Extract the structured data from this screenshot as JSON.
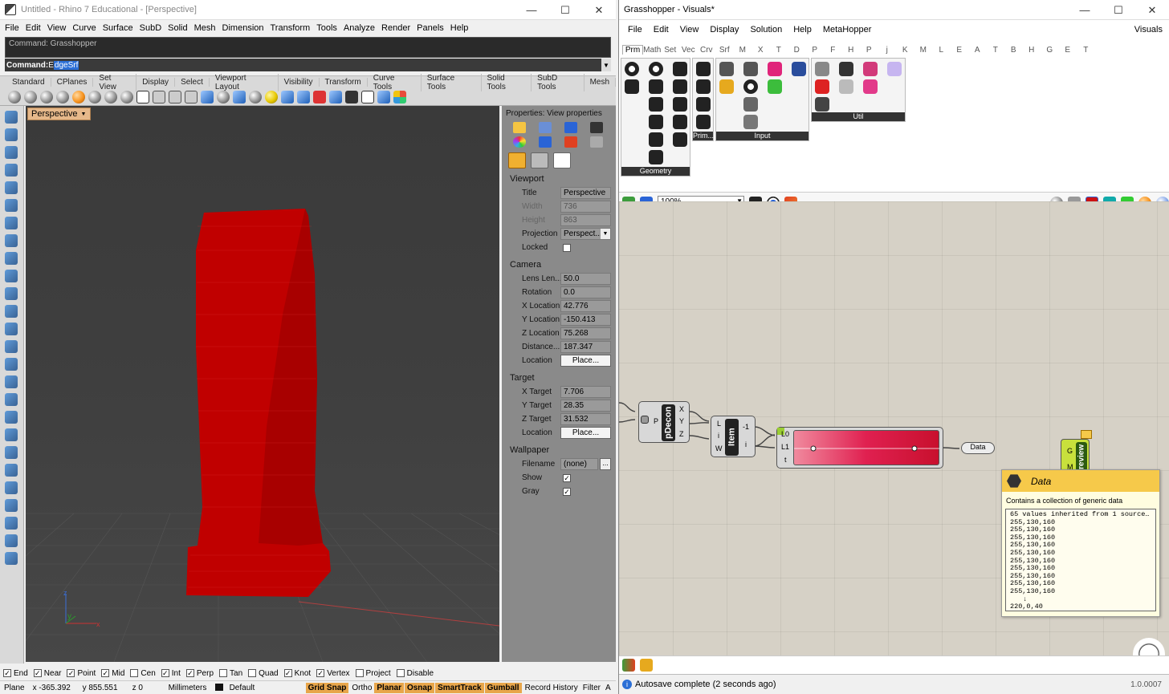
{
  "rhino": {
    "title": "Untitled - Rhino 7 Educational - [Perspective]",
    "menu": [
      "File",
      "Edit",
      "View",
      "Curve",
      "Surface",
      "SubD",
      "Solid",
      "Mesh",
      "Dimension",
      "Transform",
      "Tools",
      "Analyze",
      "Render",
      "Panels",
      "Help"
    ],
    "command_history": "Command: Grasshopper",
    "command_prefix": "Command: ",
    "command_first": "E",
    "command_selected": "dgeSrf",
    "toolbar_tabs": [
      "Standard",
      "CPlanes",
      "Set View",
      "Display",
      "Select",
      "Viewport Layout",
      "Visibility",
      "Transform",
      "Curve Tools",
      "Surface Tools",
      "Solid Tools",
      "SubD Tools",
      "Mesh"
    ],
    "viewport_label": "Perspective",
    "axis_x": "x",
    "axis_y": "y",
    "axis_z": "z",
    "model_color": "#cc0000",
    "properties": {
      "header": "Properties: View properties",
      "viewport_section": "Viewport",
      "title_label": "Title",
      "title_value": "Perspective",
      "width_label": "Width",
      "width_value": "736",
      "height_label": "Height",
      "height_value": "863",
      "projection_label": "Projection",
      "projection_value": "Perspect...",
      "locked_label": "Locked",
      "camera_section": "Camera",
      "lens_label": "Lens Len...",
      "lens_value": "50.0",
      "rotation_label": "Rotation",
      "rotation_value": "0.0",
      "xloc_label": "X Location",
      "xloc_value": "42.776",
      "yloc_label": "Y Location",
      "yloc_value": "-150.413",
      "zloc_label": "Z Location",
      "zloc_value": "75.268",
      "distance_label": "Distance...",
      "distance_value": "187.347",
      "cam_location_label": "Location",
      "place_button": "Place...",
      "target_section": "Target",
      "xt_label": "X Target",
      "xt_value": "7.706",
      "yt_label": "Y Target",
      "yt_value": "28.35",
      "zt_label": "Z Target",
      "zt_value": "31.532",
      "tgt_location_label": "Location",
      "wallpaper_section": "Wallpaper",
      "filename_label": "Filename",
      "filename_value": "(none)",
      "filename_btn": "...",
      "show_label": "Show",
      "gray_label": "Gray"
    },
    "osnaps": [
      {
        "label": "End",
        "checked": true
      },
      {
        "label": "Near",
        "checked": true
      },
      {
        "label": "Point",
        "checked": true
      },
      {
        "label": "Mid",
        "checked": true
      },
      {
        "label": "Cen",
        "checked": false
      },
      {
        "label": "Int",
        "checked": true
      },
      {
        "label": "Perp",
        "checked": true
      },
      {
        "label": "Tan",
        "checked": false
      },
      {
        "label": "Quad",
        "checked": false
      },
      {
        "label": "Knot",
        "checked": true
      },
      {
        "label": "Vertex",
        "checked": true
      },
      {
        "label": "Project",
        "checked": false
      },
      {
        "label": "Disable",
        "checked": false
      }
    ],
    "status": {
      "cplane": "Plane",
      "x": "x -365.392",
      "y": "y 855.551",
      "z": "z 0",
      "units": "Millimeters",
      "layer": "Default",
      "grid_snap": "Grid Snap",
      "ortho": "Ortho",
      "planar": "Planar",
      "osnap": "Osnap",
      "smarttrack": "SmartTrack",
      "gumball": "Gumball",
      "record_history": "Record History",
      "filter": "Filter",
      "filter_tail": "A"
    }
  },
  "grasshopper": {
    "title": "Grasshopper - Visuals*",
    "menu": [
      "File",
      "Edit",
      "View",
      "Display",
      "Solution",
      "Help",
      "MetaHopper"
    ],
    "doc_label": "Visuals",
    "tabs": [
      "Prm",
      "Math",
      "Set",
      "Vec",
      "Crv",
      "Srf",
      "M",
      "X",
      "T",
      "D",
      "P",
      "F",
      "H",
      "P",
      "j",
      "K",
      "M",
      "L",
      "E",
      "A",
      "T",
      "B",
      "H",
      "G",
      "E",
      "T"
    ],
    "panels": {
      "geometry": "Geometry",
      "primitive": "Prim...",
      "input": "Input",
      "util": "Util"
    },
    "zoom": "100%",
    "components": {
      "pdecon_name": "pDecon",
      "pdecon_in": "P",
      "pdecon_out": [
        "X",
        "Y",
        "Z"
      ],
      "item_name": "Item",
      "item_in": [
        "L",
        "i",
        "W"
      ],
      "item_out": [
        "-1",
        "i"
      ],
      "grad_in": [
        "L0",
        "L1",
        "t"
      ],
      "data_label": "Data",
      "preview_inputs": [
        "G",
        "M"
      ],
      "preview_name": "review"
    },
    "tooltip": {
      "title": "Data",
      "description": "Contains a collection of generic data",
      "lines": [
        "65 values inherited from 1 source…",
        "255,130,160",
        "255,130,160",
        "255,130,160",
        "255,130,160",
        "255,130,160",
        "255,130,160",
        "255,130,160",
        "255,130,160",
        "255,130,160",
        "255,130,160",
        "↓",
        "220,0,40"
      ]
    },
    "status": "Autosave complete (2 seconds ago)",
    "version": "1.0.0007",
    "accent": "#f6c94a",
    "canvas_color": "#d6d1c6"
  }
}
